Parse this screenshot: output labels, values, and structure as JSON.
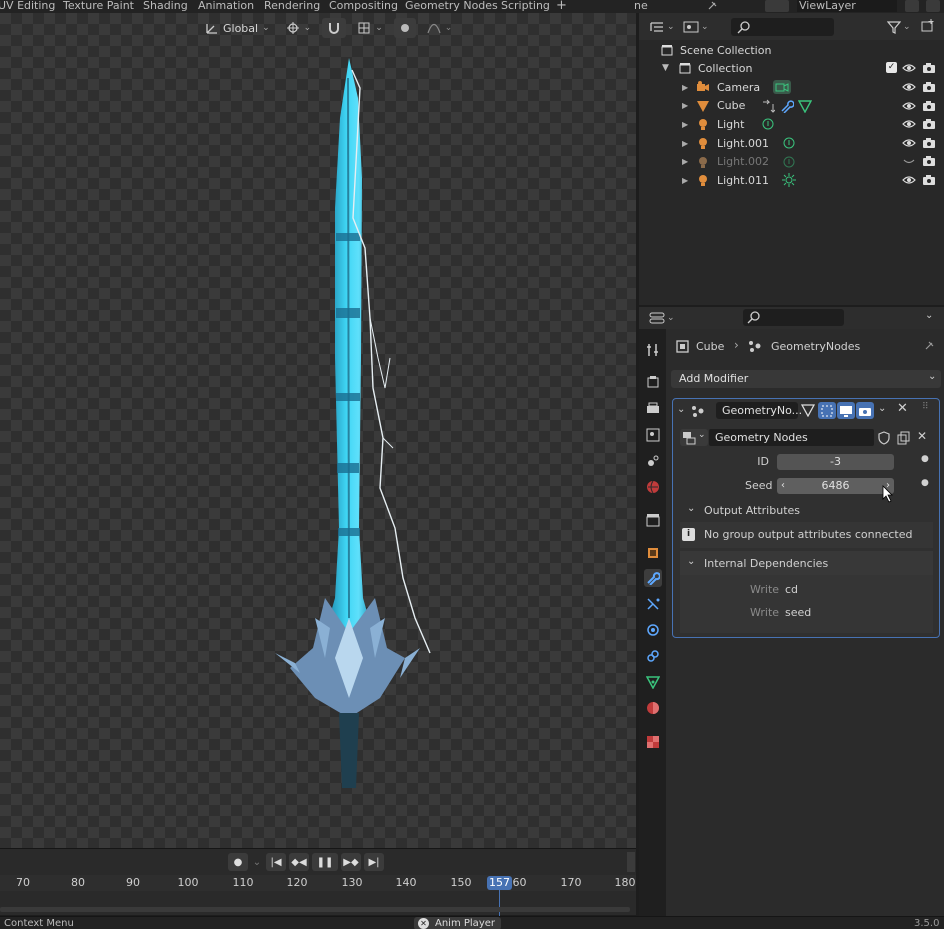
{
  "workspace_tabs": [
    "UV Editing",
    "Texture Paint",
    "Shading",
    "Animation",
    "Rendering",
    "Compositing",
    "Geometry Nodes",
    "Scripting"
  ],
  "add_tab": "+",
  "scene_short": "ne",
  "view_layer": "ViewLayer",
  "viewport": {
    "orientation": "Global"
  },
  "outliner": {
    "root": "Scene Collection",
    "collection": "Collection",
    "items": [
      {
        "name": "Camera",
        "type": "camera",
        "color": "#e08d3c",
        "visible": true,
        "dimmed": false
      },
      {
        "name": "Cube",
        "type": "mesh",
        "color": "#e08d3c",
        "visible": true,
        "dimmed": false
      },
      {
        "name": "Light",
        "type": "light",
        "color": "#e08d3c",
        "visible": true,
        "dimmed": false
      },
      {
        "name": "Light.001",
        "type": "light",
        "color": "#e08d3c",
        "visible": true,
        "dimmed": false
      },
      {
        "name": "Light.002",
        "type": "light",
        "color": "#8a6a4a",
        "visible": false,
        "dimmed": true
      },
      {
        "name": "Light.011",
        "type": "light",
        "color": "#e08d3c",
        "visible": true,
        "dimmed": false
      }
    ]
  },
  "properties": {
    "breadcrumb": {
      "object": "Cube",
      "modifier": "GeometryNodes"
    },
    "add_modifier": "Add Modifier",
    "modifier_name": "GeometryNo...",
    "node_group": "Geometry Nodes",
    "inputs": [
      {
        "label": "ID",
        "value": "-3"
      },
      {
        "label": "Seed",
        "value": "6486"
      }
    ],
    "output_attributes": {
      "title": "Output Attributes",
      "message": "No group output attributes connected"
    },
    "internal_dependencies": {
      "title": "Internal Dependencies",
      "rows": [
        {
          "label": "Write",
          "value": "cd"
        },
        {
          "label": "Write",
          "value": "seed"
        }
      ]
    }
  },
  "timeline": {
    "ticks": [
      "70",
      "80",
      "90",
      "100",
      "110",
      "120",
      "130",
      "140",
      "150",
      "160",
      "170",
      "180"
    ],
    "current_frame": "157"
  },
  "statusbar": {
    "left": "Context Menu",
    "center": "Anim Player",
    "version": "3.5.0"
  },
  "colors": {
    "accent": "#4772b3",
    "sword_glow": "#3fd6f5",
    "object_orange": "#e08d3c",
    "data_green": "#3ac47d"
  }
}
